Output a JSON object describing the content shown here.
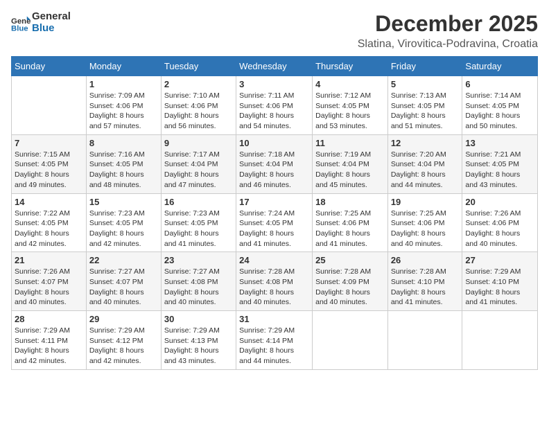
{
  "logo": {
    "line1": "General",
    "line2": "Blue"
  },
  "title": "December 2025",
  "subtitle": "Slatina, Virovitica-Podravina, Croatia",
  "days_header": [
    "Sunday",
    "Monday",
    "Tuesday",
    "Wednesday",
    "Thursday",
    "Friday",
    "Saturday"
  ],
  "weeks": [
    [
      {
        "day": "",
        "info": ""
      },
      {
        "day": "1",
        "info": "Sunrise: 7:09 AM\nSunset: 4:06 PM\nDaylight: 8 hours\nand 57 minutes."
      },
      {
        "day": "2",
        "info": "Sunrise: 7:10 AM\nSunset: 4:06 PM\nDaylight: 8 hours\nand 56 minutes."
      },
      {
        "day": "3",
        "info": "Sunrise: 7:11 AM\nSunset: 4:06 PM\nDaylight: 8 hours\nand 54 minutes."
      },
      {
        "day": "4",
        "info": "Sunrise: 7:12 AM\nSunset: 4:05 PM\nDaylight: 8 hours\nand 53 minutes."
      },
      {
        "day": "5",
        "info": "Sunrise: 7:13 AM\nSunset: 4:05 PM\nDaylight: 8 hours\nand 51 minutes."
      },
      {
        "day": "6",
        "info": "Sunrise: 7:14 AM\nSunset: 4:05 PM\nDaylight: 8 hours\nand 50 minutes."
      }
    ],
    [
      {
        "day": "7",
        "info": "Sunrise: 7:15 AM\nSunset: 4:05 PM\nDaylight: 8 hours\nand 49 minutes."
      },
      {
        "day": "8",
        "info": "Sunrise: 7:16 AM\nSunset: 4:05 PM\nDaylight: 8 hours\nand 48 minutes."
      },
      {
        "day": "9",
        "info": "Sunrise: 7:17 AM\nSunset: 4:04 PM\nDaylight: 8 hours\nand 47 minutes."
      },
      {
        "day": "10",
        "info": "Sunrise: 7:18 AM\nSunset: 4:04 PM\nDaylight: 8 hours\nand 46 minutes."
      },
      {
        "day": "11",
        "info": "Sunrise: 7:19 AM\nSunset: 4:04 PM\nDaylight: 8 hours\nand 45 minutes."
      },
      {
        "day": "12",
        "info": "Sunrise: 7:20 AM\nSunset: 4:04 PM\nDaylight: 8 hours\nand 44 minutes."
      },
      {
        "day": "13",
        "info": "Sunrise: 7:21 AM\nSunset: 4:05 PM\nDaylight: 8 hours\nand 43 minutes."
      }
    ],
    [
      {
        "day": "14",
        "info": "Sunrise: 7:22 AM\nSunset: 4:05 PM\nDaylight: 8 hours\nand 42 minutes."
      },
      {
        "day": "15",
        "info": "Sunrise: 7:23 AM\nSunset: 4:05 PM\nDaylight: 8 hours\nand 42 minutes."
      },
      {
        "day": "16",
        "info": "Sunrise: 7:23 AM\nSunset: 4:05 PM\nDaylight: 8 hours\nand 41 minutes."
      },
      {
        "day": "17",
        "info": "Sunrise: 7:24 AM\nSunset: 4:05 PM\nDaylight: 8 hours\nand 41 minutes."
      },
      {
        "day": "18",
        "info": "Sunrise: 7:25 AM\nSunset: 4:06 PM\nDaylight: 8 hours\nand 41 minutes."
      },
      {
        "day": "19",
        "info": "Sunrise: 7:25 AM\nSunset: 4:06 PM\nDaylight: 8 hours\nand 40 minutes."
      },
      {
        "day": "20",
        "info": "Sunrise: 7:26 AM\nSunset: 4:06 PM\nDaylight: 8 hours\nand 40 minutes."
      }
    ],
    [
      {
        "day": "21",
        "info": "Sunrise: 7:26 AM\nSunset: 4:07 PM\nDaylight: 8 hours\nand 40 minutes."
      },
      {
        "day": "22",
        "info": "Sunrise: 7:27 AM\nSunset: 4:07 PM\nDaylight: 8 hours\nand 40 minutes."
      },
      {
        "day": "23",
        "info": "Sunrise: 7:27 AM\nSunset: 4:08 PM\nDaylight: 8 hours\nand 40 minutes."
      },
      {
        "day": "24",
        "info": "Sunrise: 7:28 AM\nSunset: 4:08 PM\nDaylight: 8 hours\nand 40 minutes."
      },
      {
        "day": "25",
        "info": "Sunrise: 7:28 AM\nSunset: 4:09 PM\nDaylight: 8 hours\nand 40 minutes."
      },
      {
        "day": "26",
        "info": "Sunrise: 7:28 AM\nSunset: 4:10 PM\nDaylight: 8 hours\nand 41 minutes."
      },
      {
        "day": "27",
        "info": "Sunrise: 7:29 AM\nSunset: 4:10 PM\nDaylight: 8 hours\nand 41 minutes."
      }
    ],
    [
      {
        "day": "28",
        "info": "Sunrise: 7:29 AM\nSunset: 4:11 PM\nDaylight: 8 hours\nand 42 minutes."
      },
      {
        "day": "29",
        "info": "Sunrise: 7:29 AM\nSunset: 4:12 PM\nDaylight: 8 hours\nand 42 minutes."
      },
      {
        "day": "30",
        "info": "Sunrise: 7:29 AM\nSunset: 4:13 PM\nDaylight: 8 hours\nand 43 minutes."
      },
      {
        "day": "31",
        "info": "Sunrise: 7:29 AM\nSunset: 4:14 PM\nDaylight: 8 hours\nand 44 minutes."
      },
      {
        "day": "",
        "info": ""
      },
      {
        "day": "",
        "info": ""
      },
      {
        "day": "",
        "info": ""
      }
    ]
  ]
}
